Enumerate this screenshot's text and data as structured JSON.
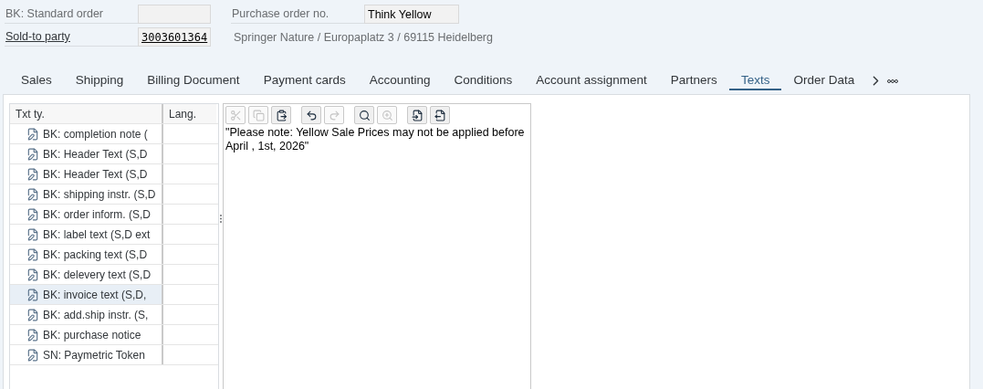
{
  "header": {
    "order_type": {
      "label": "BK: Standard order"
    },
    "purchase_order": {
      "label": "Purchase order no.",
      "value": "Think Yellow"
    },
    "sold_to": {
      "label": "Sold-to party",
      "value": "3003601364",
      "description": "Springer Nature / Europaplatz 3 / 69115 Heidelberg"
    }
  },
  "tabs": [
    {
      "label": "Sales",
      "selected": false
    },
    {
      "label": "Shipping",
      "selected": false
    },
    {
      "label": "Billing Document",
      "selected": false
    },
    {
      "label": "Payment cards",
      "selected": false
    },
    {
      "label": "Accounting",
      "selected": false
    },
    {
      "label": "Conditions",
      "selected": false
    },
    {
      "label": "Account assignment",
      "selected": false
    },
    {
      "label": "Partners",
      "selected": false
    },
    {
      "label": "Texts",
      "selected": true
    },
    {
      "label": "Order Data",
      "selected": false
    }
  ],
  "text_types": {
    "columns": [
      "Txt ty.",
      "Lang."
    ],
    "rows": [
      {
        "name": "BK: completion note (",
        "selected": false
      },
      {
        "name": "BK: Header Text (S,D",
        "selected": false
      },
      {
        "name": "BK: Header Text (S,D",
        "selected": false
      },
      {
        "name": "BK: shipping instr. (S,D",
        "selected": false
      },
      {
        "name": "BK: order inform. (S,D",
        "selected": false
      },
      {
        "name": "BK: label text (S,D ext",
        "selected": false
      },
      {
        "name": "BK: packing text (S,D",
        "selected": false
      },
      {
        "name": "BK: delevery text (S,D",
        "selected": false
      },
      {
        "name": "BK: invoice text (S,D,",
        "selected": true
      },
      {
        "name": "BK: add.ship instr. (S,",
        "selected": false
      },
      {
        "name": "BK: purchase notice",
        "selected": false
      },
      {
        "name": "SN: Paymetric Token",
        "selected": false
      }
    ]
  },
  "editor": {
    "toolbar": [
      {
        "kind": "cut",
        "disabled": true
      },
      {
        "kind": "copy",
        "disabled": true
      },
      {
        "kind": "paste",
        "disabled": false
      },
      {
        "kind": "undo",
        "disabled": false
      },
      {
        "kind": "redo",
        "disabled": true
      },
      {
        "kind": "find",
        "disabled": false
      },
      {
        "kind": "find-next",
        "disabled": true
      },
      {
        "kind": "import",
        "disabled": false
      },
      {
        "kind": "export",
        "disabled": false
      }
    ],
    "text": "\"Please note: Yellow Sale Prices may not be applied before April , 1st, 2026\""
  }
}
